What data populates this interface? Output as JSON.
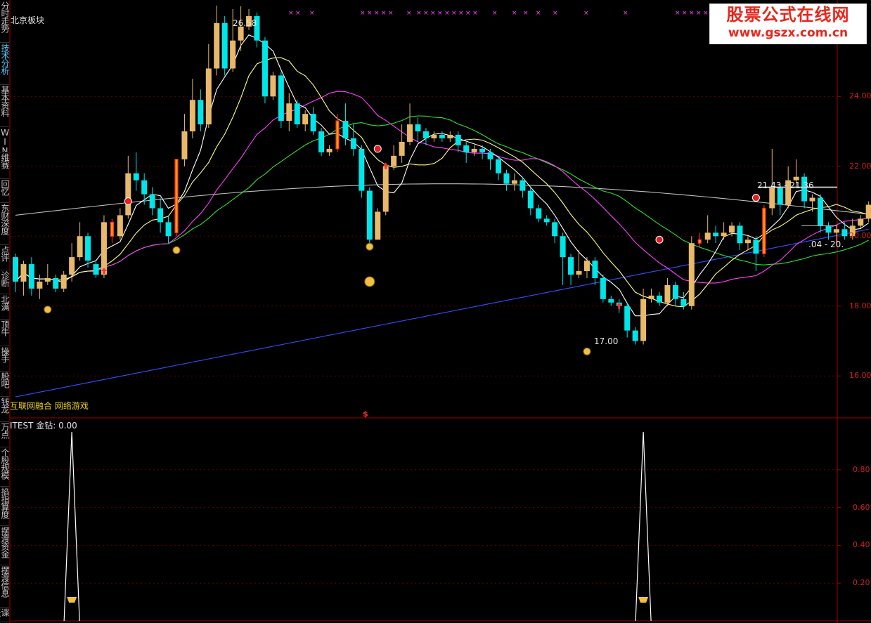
{
  "top_label": "北京板块",
  "concept_label": "互联网融合 网络游戏",
  "sub_indicator": "ITEST  金钻: 0.00",
  "sub_marker": "$",
  "watermark": {
    "line1": "股票公式在线网",
    "line2": "www.gszx.com.cn"
  },
  "sidebar": [
    "分时走势",
    "技术分析",
    "基本资料",
    "WIND",
    "维赛",
    "回忆",
    "东财深度",
    "点评",
    "诊断",
    "北满",
    "顶牛",
    "操手",
    "股吧",
    "钱龙",
    "万点",
    "个股规模",
    "掐指算度",
    "摆渡资金",
    "摆渡信息",
    "谍报"
  ],
  "annotations": {
    "high": "26.58",
    "low": "17.00",
    "range1": "21.43 - 21.36",
    "range2": ".04 - 20."
  },
  "colors": {
    "up": "#e8b96a",
    "down": "#00e5e8",
    "limit": "#ff3030",
    "ma5": "#ffffff",
    "ma10": "#ffff80",
    "ma20": "#ff40ff",
    "ma30": "#30e030",
    "ma60": "#c0c0c0",
    "ma120": "#3050ff"
  },
  "chart_data": [
    {
      "type": "candlestick",
      "ylim": [
        15,
        26.8
      ],
      "y_ticks": [
        16.0,
        18.0,
        20.0,
        22.0,
        24.0
      ],
      "candles": [
        [
          19.4,
          18.7,
          19.5,
          18.4
        ],
        [
          18.7,
          19.2,
          19.3,
          18.3
        ],
        [
          19.2,
          18.5,
          19.4,
          18.3
        ],
        [
          18.5,
          18.7,
          18.9,
          18.2
        ],
        [
          18.7,
          18.8,
          19.2,
          18.6
        ],
        [
          18.8,
          18.5,
          18.9,
          18.4
        ],
        [
          18.5,
          18.9,
          19.0,
          18.4
        ],
        [
          18.9,
          19.4,
          19.8,
          18.7
        ],
        [
          19.4,
          20.0,
          20.4,
          19.3
        ],
        [
          20.0,
          19.3,
          20.1,
          19.1
        ],
        [
          19.2,
          18.9,
          19.3,
          18.8
        ],
        [
          18.9,
          20.4,
          20.6,
          18.8
        ],
        [
          20.4,
          20.0,
          20.5,
          19.8
        ],
        [
          20.0,
          20.6,
          20.8,
          19.9
        ],
        [
          20.6,
          21.8,
          22.3,
          20.5
        ],
        [
          21.8,
          21.6,
          22.4,
          21.3
        ],
        [
          21.6,
          21.2,
          21.8,
          20.9
        ],
        [
          21.2,
          20.8,
          21.4,
          20.6
        ],
        [
          20.8,
          20.4,
          21.1,
          20.1
        ],
        [
          20.4,
          20.0,
          20.6,
          19.8
        ],
        [
          20.1,
          22.2,
          22.2,
          20.0
        ],
        [
          22.2,
          23.0,
          23.5,
          22.0
        ],
        [
          23.0,
          23.9,
          24.5,
          22.8
        ],
        [
          23.9,
          23.2,
          24.2,
          23.0
        ],
        [
          23.2,
          24.8,
          25.5,
          23.1
        ],
        [
          24.8,
          26.1,
          26.6,
          24.6
        ],
        [
          26.1,
          24.8,
          26.3,
          24.6
        ],
        [
          24.8,
          25.6,
          26.5,
          24.7
        ],
        [
          25.6,
          26.0,
          26.58,
          25.3
        ],
        [
          26.0,
          26.3,
          26.5,
          25.9
        ],
        [
          26.3,
          25.6,
          26.4,
          25.4
        ],
        [
          25.6,
          24.0,
          25.7,
          23.8
        ],
        [
          24.0,
          24.6,
          24.7,
          23.9
        ],
        [
          24.6,
          23.3,
          24.7,
          23.1
        ],
        [
          23.3,
          23.8,
          24.1,
          23.0
        ],
        [
          23.8,
          23.2,
          23.9,
          23.1
        ],
        [
          23.2,
          23.5,
          23.6,
          23.0
        ],
        [
          23.5,
          23.0,
          23.7,
          22.9
        ],
        [
          23.0,
          22.4,
          23.1,
          22.3
        ],
        [
          22.4,
          22.5,
          22.6,
          22.3
        ],
        [
          22.5,
          23.3,
          23.5,
          22.4
        ],
        [
          23.3,
          22.8,
          23.8,
          22.6
        ],
        [
          22.8,
          22.5,
          23.2,
          22.3
        ],
        [
          22.5,
          21.3,
          22.6,
          21.1
        ],
        [
          21.3,
          19.9,
          21.4,
          19.8
        ],
        [
          19.9,
          20.7,
          20.8,
          19.9
        ],
        [
          20.7,
          22.0,
          22.1,
          20.6
        ],
        [
          22.0,
          22.3,
          22.6,
          21.9
        ],
        [
          22.3,
          22.7,
          23.2,
          22.1
        ],
        [
          22.7,
          23.2,
          23.8,
          22.6
        ],
        [
          23.2,
          23.0,
          23.4,
          22.7
        ],
        [
          23.0,
          22.8,
          23.1,
          22.6
        ],
        [
          22.8,
          22.9,
          23.0,
          22.7
        ],
        [
          22.9,
          22.8,
          23.0,
          22.7
        ],
        [
          22.8,
          22.9,
          23.0,
          22.7
        ],
        [
          22.9,
          22.6,
          23.0,
          22.4
        ],
        [
          22.6,
          22.4,
          22.7,
          22.1
        ],
        [
          22.4,
          22.5,
          22.6,
          22.3
        ],
        [
          22.5,
          22.4,
          22.6,
          22.2
        ],
        [
          22.4,
          22.2,
          22.5,
          21.9
        ],
        [
          22.2,
          21.8,
          22.3,
          21.6
        ],
        [
          21.8,
          21.5,
          21.9,
          21.3
        ],
        [
          21.5,
          21.6,
          21.8,
          21.3
        ],
        [
          21.6,
          21.3,
          21.7,
          21.1
        ],
        [
          21.3,
          20.8,
          21.4,
          20.6
        ],
        [
          20.8,
          20.5,
          20.9,
          20.4
        ],
        [
          20.5,
          20.4,
          20.6,
          20.3
        ],
        [
          20.4,
          20.0,
          20.5,
          19.8
        ],
        [
          20.0,
          19.4,
          20.1,
          18.6
        ],
        [
          19.4,
          18.9,
          19.5,
          18.6
        ],
        [
          18.9,
          19.0,
          19.6,
          18.8
        ],
        [
          19.0,
          19.3,
          19.4,
          18.8
        ],
        [
          19.3,
          18.8,
          19.4,
          18.6
        ],
        [
          18.8,
          18.2,
          18.9,
          18.1
        ],
        [
          18.2,
          18.1,
          18.3,
          18.0
        ],
        [
          18.1,
          18.0,
          18.2,
          17.8
        ],
        [
          18.0,
          17.3,
          18.1,
          17.1
        ],
        [
          17.3,
          17.0,
          17.4,
          16.9
        ],
        [
          17.0,
          18.2,
          18.5,
          16.9
        ],
        [
          18.2,
          18.3,
          18.5,
          18.1
        ],
        [
          18.3,
          18.1,
          18.4,
          18.0
        ],
        [
          18.1,
          18.6,
          18.8,
          18.0
        ],
        [
          18.6,
          18.2,
          18.7,
          18.0
        ],
        [
          18.2,
          18.0,
          18.4,
          17.9
        ],
        [
          18.0,
          19.8,
          20.0,
          17.9
        ],
        [
          19.8,
          19.9,
          20.1,
          19.7
        ],
        [
          19.9,
          20.1,
          20.6,
          19.8
        ],
        [
          20.1,
          20.0,
          20.3,
          19.8
        ],
        [
          20.0,
          20.1,
          20.4,
          19.9
        ],
        [
          20.1,
          20.3,
          20.4,
          20.0
        ],
        [
          20.3,
          19.8,
          20.4,
          19.6
        ],
        [
          19.8,
          19.9,
          20.0,
          19.6
        ],
        [
          19.9,
          19.5,
          20.0,
          19.0
        ],
        [
          19.5,
          20.8,
          20.9,
          19.4
        ],
        [
          20.8,
          21.4,
          22.5,
          20.6
        ],
        [
          21.4,
          20.9,
          21.5,
          20.6
        ],
        [
          20.9,
          21.6,
          22.0,
          20.8
        ],
        [
          21.6,
          21.7,
          22.2,
          21.4
        ],
        [
          21.7,
          21.0,
          21.8,
          20.8
        ],
        [
          21.0,
          21.1,
          21.2,
          20.7
        ],
        [
          21.1,
          20.3,
          21.2,
          20.1
        ],
        [
          20.3,
          20.1,
          20.4,
          19.9
        ],
        [
          20.1,
          20.2,
          20.3,
          19.8
        ],
        [
          20.2,
          20.0,
          20.4,
          19.9
        ],
        [
          20.0,
          20.3,
          20.5,
          19.9
        ],
        [
          20.3,
          20.5,
          20.6,
          20.2
        ],
        [
          20.5,
          20.9,
          21.0,
          20.4
        ]
      ]
    },
    {
      "type": "line",
      "ylim": [
        0,
        1
      ],
      "y_ticks": [
        0.2,
        0.4,
        0.6,
        0.8
      ],
      "spikes": [
        {
          "x": 7,
          "value": 1
        },
        {
          "x": 78,
          "value": 1
        }
      ]
    }
  ]
}
